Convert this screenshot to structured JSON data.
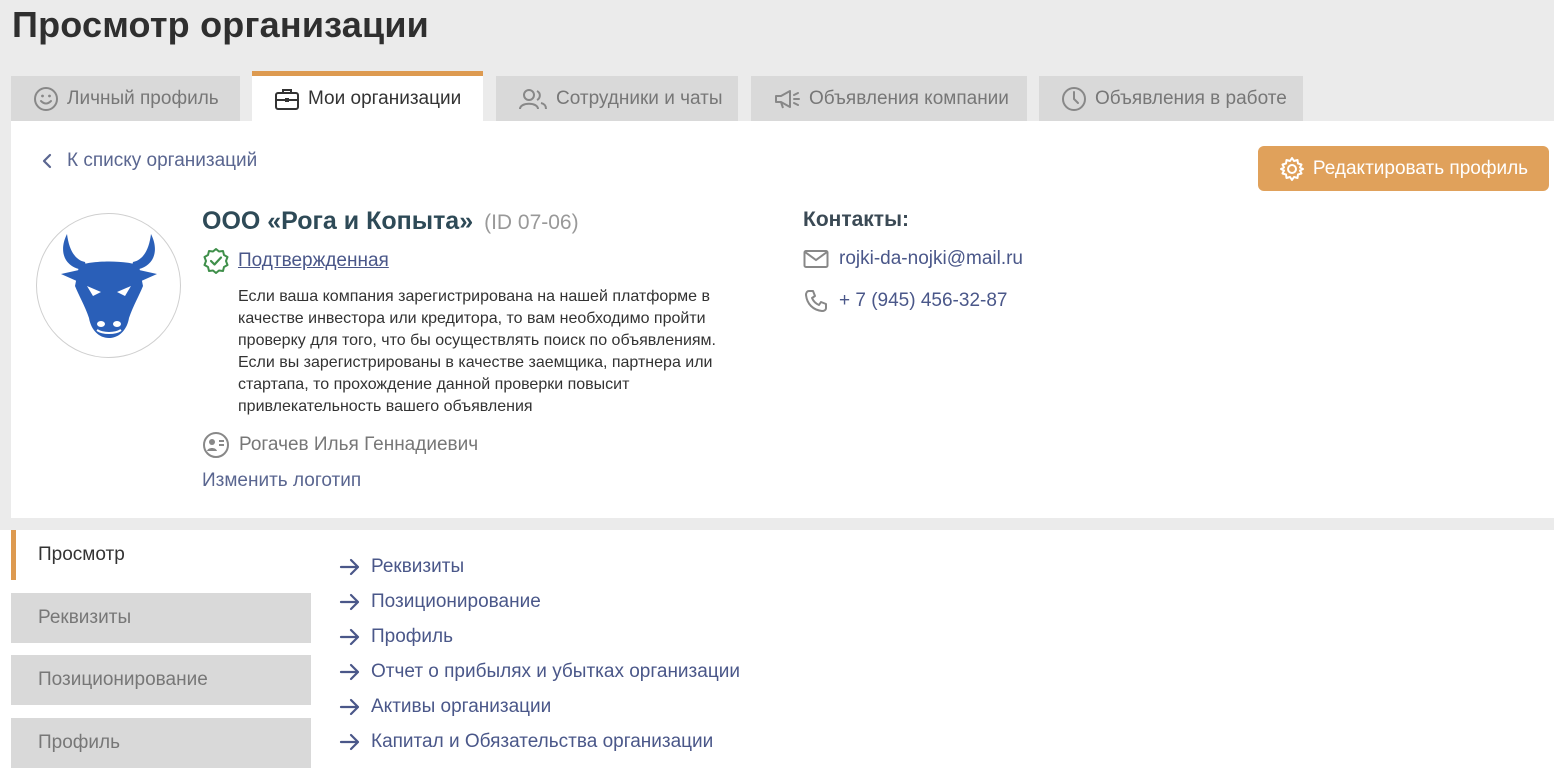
{
  "page": {
    "title": "Просмотр организации"
  },
  "tabs": [
    {
      "label": "Личный профиль",
      "icon": "smiley-icon"
    },
    {
      "label": "Мои организации",
      "icon": "briefcase-icon"
    },
    {
      "label": "Сотрудники и чаты",
      "icon": "users-icon"
    },
    {
      "label": "Объявления компании",
      "icon": "megaphone-icon"
    },
    {
      "label": "Объявления в работе",
      "icon": "clock-icon"
    }
  ],
  "active_tab": "Мои организации",
  "header": {
    "back_label": "К списку организаций",
    "edit_label": "Редактировать профиль"
  },
  "org": {
    "name": "ООО «Рога и Копыта»",
    "id": "(ID 07-06)",
    "status": "Подтвержденная",
    "note": "Если ваша компания зарегистрирована на нашей платформе в качестве инвестора или кредитора, то вам необходимо пройти проверку для того, что бы осуществлять поиск по объявлениям. Если вы зарегистрированы в качестве заемщика, партнера или стартапа, то прохождение данной проверки повысит привлекательность вашего объявления",
    "owner": "Рогачев Илья Геннадиевич",
    "change_logo": "Изменить логотип"
  },
  "contacts": {
    "title": "Контакты:",
    "email": "rojki-da-nojki@mail.ru",
    "phone": "+ 7 (945) 456-32-87"
  },
  "sidebar": {
    "items": [
      {
        "label": "Просмотр"
      },
      {
        "label": "Реквизиты"
      },
      {
        "label": "Позиционирование"
      },
      {
        "label": "Профиль"
      }
    ],
    "active": "Просмотр"
  },
  "links": [
    "Реквизиты",
    "Позиционирование",
    "Профиль",
    "Отчет о прибылях и убытках организации",
    "Активы организации",
    "Капитал и Обязательства организации"
  ],
  "colors": {
    "accent": "#dd9a50",
    "button": "#e0a15b",
    "link": "#4a5789",
    "logo_blue": "#2a5fb8",
    "verified_green": "#3f8f4a"
  }
}
